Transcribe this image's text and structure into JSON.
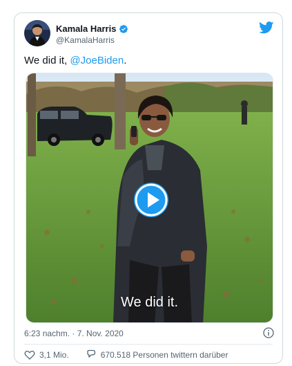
{
  "author": {
    "name": "Kamala Harris",
    "handle": "@KamalaHarris"
  },
  "tweet": {
    "text": "We did it, ",
    "mention": "@JoeBiden",
    "trailing": "."
  },
  "media": {
    "caption": "We did it."
  },
  "meta": {
    "timestamp": "6:23 nachm. · 7. Nov. 2020"
  },
  "actions": {
    "likes": "3,1 Mio.",
    "replies_label": "670.518 Personen twittern darüber"
  },
  "colors": {
    "accent": "#1d9bf0",
    "text": "#0f1419",
    "muted": "#536471"
  },
  "icons": {
    "logo": "twitter-bird-icon",
    "verified": "verified-badge-icon",
    "play": "play-icon",
    "info": "info-icon",
    "like": "heart-icon",
    "reply": "speech-bubble-icon"
  }
}
